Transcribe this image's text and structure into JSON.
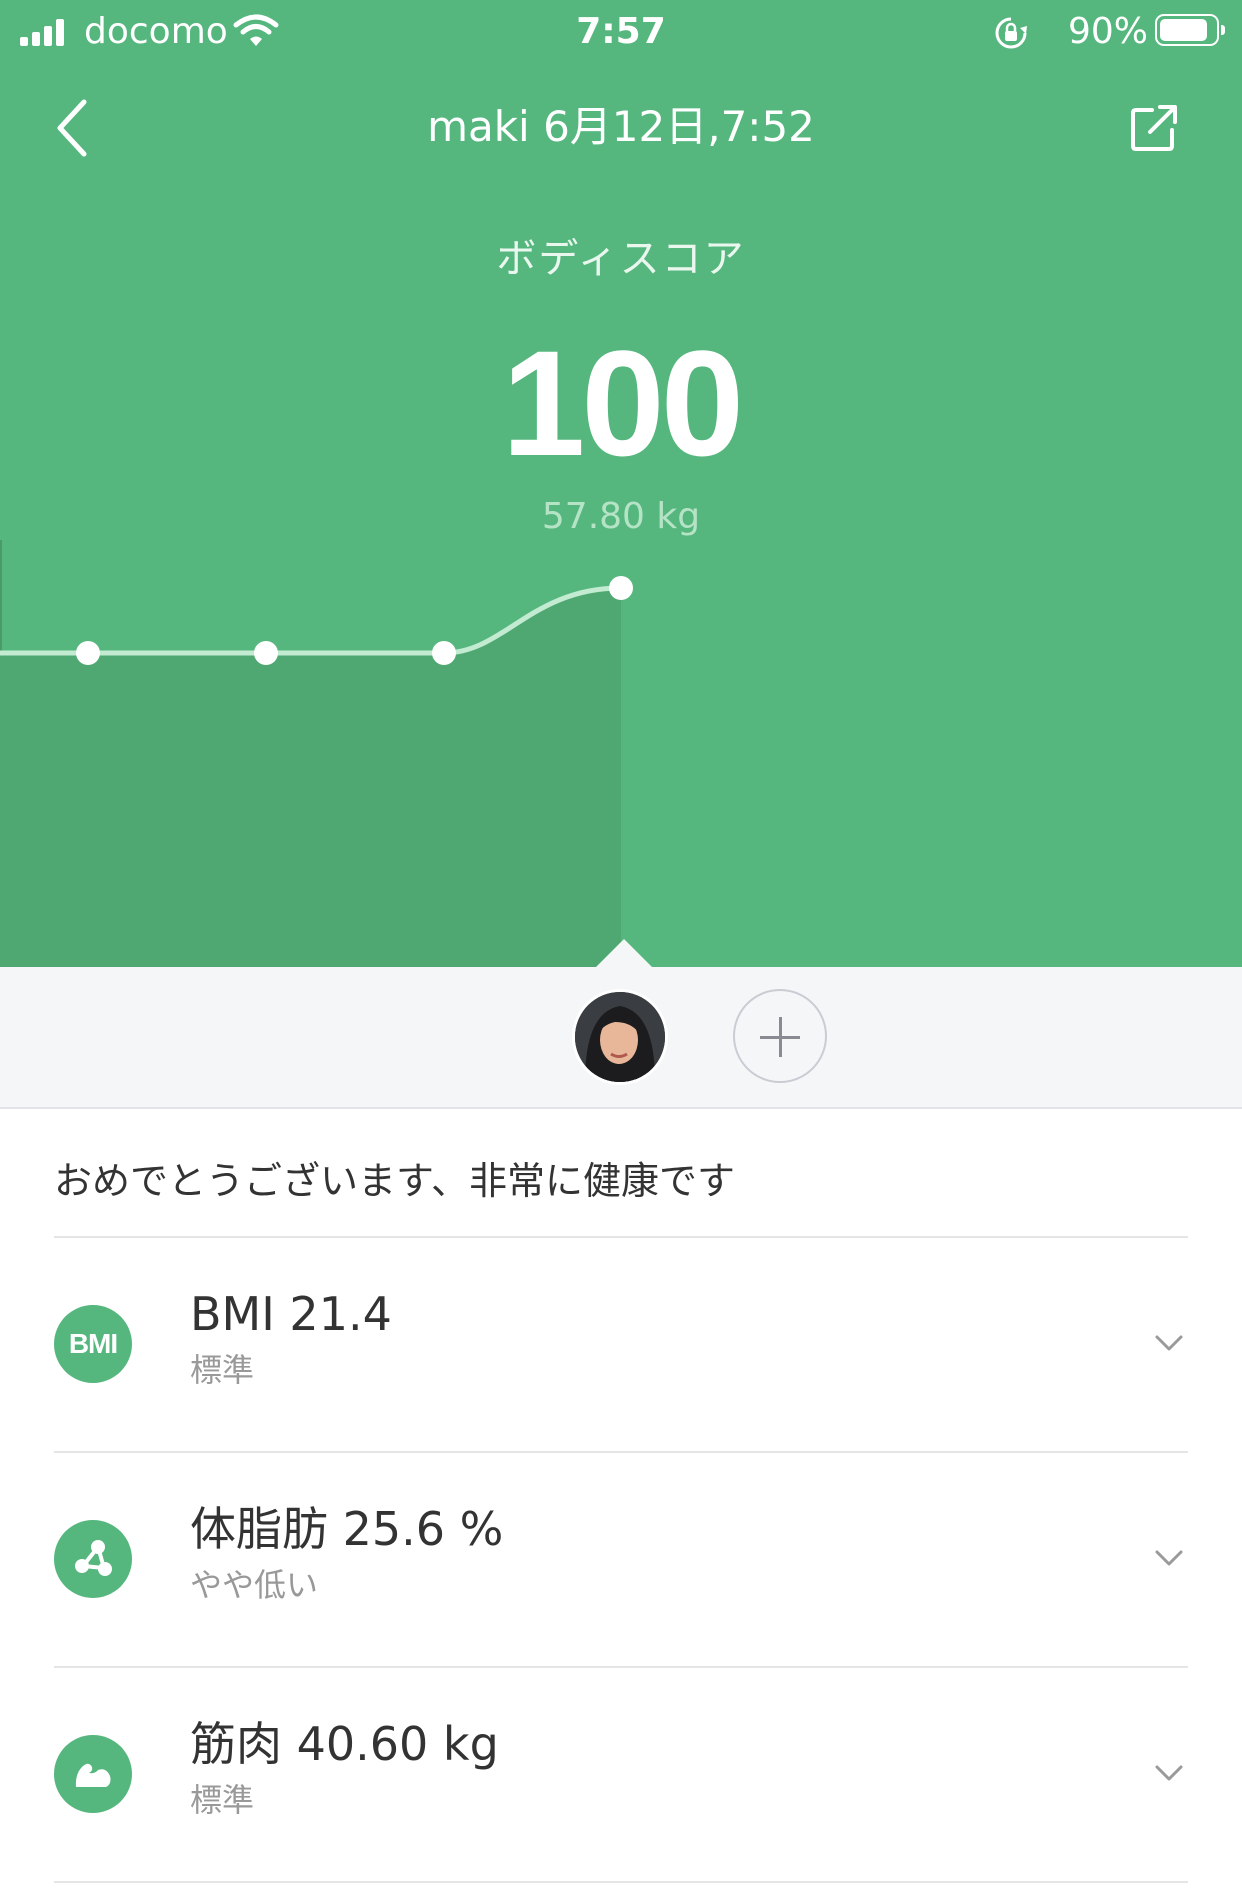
{
  "status_bar": {
    "carrier": "docomo",
    "time": "7:57",
    "battery_percent": "90%",
    "battery_level": 0.9
  },
  "header": {
    "title": "maki 6月12日,7:52",
    "back_icon": "chevron-left-icon",
    "share_icon": "share-icon"
  },
  "score": {
    "label": "ボディスコア",
    "value": "100",
    "weight": "57.80 kg"
  },
  "colors": {
    "brand_green": "#55b77e",
    "trend_fill": "#4fa871",
    "background": "#ffffff",
    "switcher_bg": "#f5f6f8"
  },
  "trend": {
    "values": [
      96,
      96,
      96,
      100
    ]
  },
  "profile": {
    "avatar_icon": "user-avatar",
    "add_icon": "plus-icon"
  },
  "message": "おめでとうございます、非常に健康です",
  "metrics": [
    {
      "icon": "bmi-icon",
      "icon_text": "BMI",
      "title": "BMI 21.4",
      "status": "標準"
    },
    {
      "icon": "body-fat-icon",
      "title": "体脂肪 25.6 %",
      "status": "やや低い"
    },
    {
      "icon": "muscle-icon",
      "title": "筋肉 40.60 kg",
      "status": "標準"
    }
  ]
}
